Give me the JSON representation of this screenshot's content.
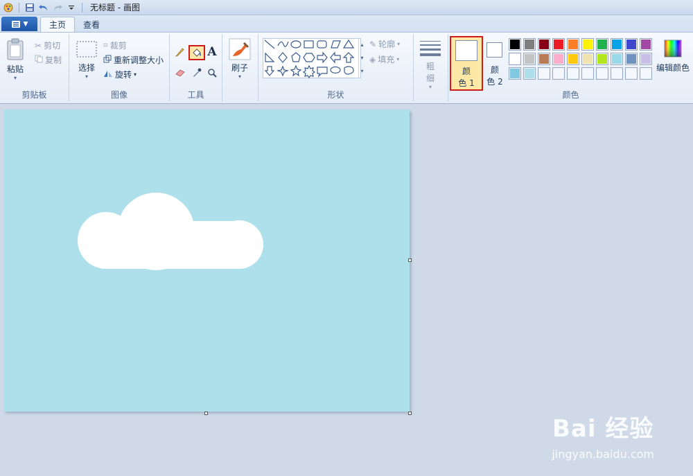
{
  "window": {
    "title": "无标题 - 画图"
  },
  "tabs": [
    {
      "label": "主页"
    },
    {
      "label": "查看"
    }
  ],
  "clipboard": {
    "paste_label": "粘贴",
    "cut_label": "剪切",
    "copy_label": "复制",
    "group_label": "剪贴板"
  },
  "image": {
    "select_label": "选择",
    "crop_label": "裁剪",
    "resize_label": "重新调整大小",
    "rotate_label": "旋转",
    "group_label": "图像"
  },
  "tools": {
    "group_label": "工具"
  },
  "brush": {
    "label": "刷子"
  },
  "shapes": {
    "group_label": "形状",
    "outline_label": "轮廓",
    "fill_label": "填充"
  },
  "size": {
    "label_1": "粗",
    "label_2": "细"
  },
  "colors": {
    "group_label": "颜色",
    "color1_label_1": "颜",
    "color1_label_2": "色 1",
    "color2_label_1": "颜",
    "color2_label_2": "色 2",
    "edit_label": "编辑颜色",
    "color1_value": "#ffffff",
    "color2_value": "#ffffff",
    "palette_row1": [
      "#000000",
      "#7f7f7f",
      "#880015",
      "#ed1c24",
      "#ff7f27",
      "#fff200",
      "#22b14c",
      "#00a2e8",
      "#3f48cc",
      "#a349a4"
    ],
    "palette_row2": [
      "#ffffff",
      "#c3c3c3",
      "#b97a57",
      "#ffaec9",
      "#ffc90e",
      "#efe4b0",
      "#b5e61d",
      "#99d9ea",
      "#7092be",
      "#c8bfe7"
    ],
    "palette_row3": [
      "#7fc8e0",
      "#aee0ec",
      "",
      "",
      "",
      "",
      "",
      "",
      "",
      ""
    ]
  },
  "canvas": {
    "background": "#aee0ec",
    "cloud_color": "#ffffff"
  },
  "watermark": {
    "brand": "Bai 经验",
    "url": "jingyan.baidu.com"
  }
}
